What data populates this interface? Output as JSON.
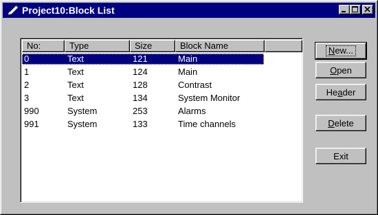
{
  "window": {
    "title": "Project10:Block List",
    "controls": {
      "minimize": "minimize-icon",
      "maximize": "maximize-icon",
      "close": "close-icon"
    }
  },
  "list": {
    "columns": [
      "No:",
      "Type",
      "Size",
      "Block Name"
    ],
    "rows": [
      {
        "no": "0",
        "type": "Text",
        "size": "121",
        "name": "Main",
        "selected": true
      },
      {
        "no": "1",
        "type": "Text",
        "size": "124",
        "name": "Main"
      },
      {
        "no": "2",
        "type": "Text",
        "size": "128",
        "name": "Contrast"
      },
      {
        "no": "3",
        "type": "Text",
        "size": "134",
        "name": "System Monitor"
      },
      {
        "no": "990",
        "type": "System",
        "size": "253",
        "name": "Alarms"
      },
      {
        "no": "991",
        "type": "System",
        "size": "133",
        "name": "Time channels"
      }
    ]
  },
  "buttons": {
    "new": {
      "mnemonic": "N",
      "rest": "ew..."
    },
    "open": {
      "mnemonic": "O",
      "rest": "pen"
    },
    "header": {
      "pre": "He",
      "mnemonic": "a",
      "rest": "der"
    },
    "delete": {
      "mnemonic": "D",
      "rest": "elete"
    },
    "exit": "Exit"
  },
  "colors": {
    "titlebar": "#000080",
    "selection": "#000080",
    "face": "#c0c0c0"
  }
}
